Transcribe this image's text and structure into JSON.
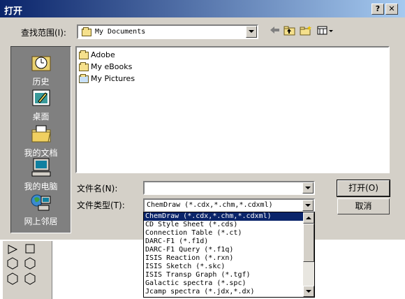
{
  "window": {
    "title": "打开",
    "help_label": "?",
    "close_label": "✕"
  },
  "lookin": {
    "label": "查找范围(I):",
    "value": "My Documents"
  },
  "toolbar": {
    "back_icon": "back-arrow-icon",
    "up_icon": "up-folder-icon",
    "new_folder_icon": "new-folder-icon",
    "view_icon": "view-menu-icon"
  },
  "places": [
    {
      "label": "历史",
      "icon": "history-icon"
    },
    {
      "label": "桌面",
      "icon": "desktop-icon"
    },
    {
      "label": "我的文档",
      "icon": "my-documents-icon"
    },
    {
      "label": "我的电脑",
      "icon": "my-computer-icon"
    },
    {
      "label": "网上邻居",
      "icon": "network-icon"
    }
  ],
  "files": [
    {
      "name": "Adobe",
      "icon": "folder-icon"
    },
    {
      "name": "My eBooks",
      "icon": "folder-icon"
    },
    {
      "name": "My Pictures",
      "icon": "pictures-folder-icon"
    }
  ],
  "filename": {
    "label": "文件名(N):",
    "value": ""
  },
  "filetype": {
    "label": "文件类型(T):",
    "value": "ChemDraw (*.cdx,*.chm,*.cdxml)",
    "options": [
      "ChemDraw (*.cdx,*.chm,*.cdxml)",
      "CD Style Sheet (*.cds)",
      "Connection Table (*.ct)",
      "DARC-F1 (*.f1d)",
      "DARC-F1 Query (*.f1q)",
      "ISIS Reaction (*.rxn)",
      "ISIS Sketch (*.skc)",
      "ISIS Transp Graph (*.tgf)",
      "Galactic spectra (*.spc)",
      "Jcamp spectra (*.jdx,*.dx)"
    ],
    "selected_index": 0
  },
  "buttons": {
    "open": "打开(O)",
    "cancel": "取消"
  },
  "colors": {
    "title_start": "#0a246a",
    "title_end": "#a6caf0",
    "selection": "#0a246a",
    "face": "#d4d0c8"
  }
}
